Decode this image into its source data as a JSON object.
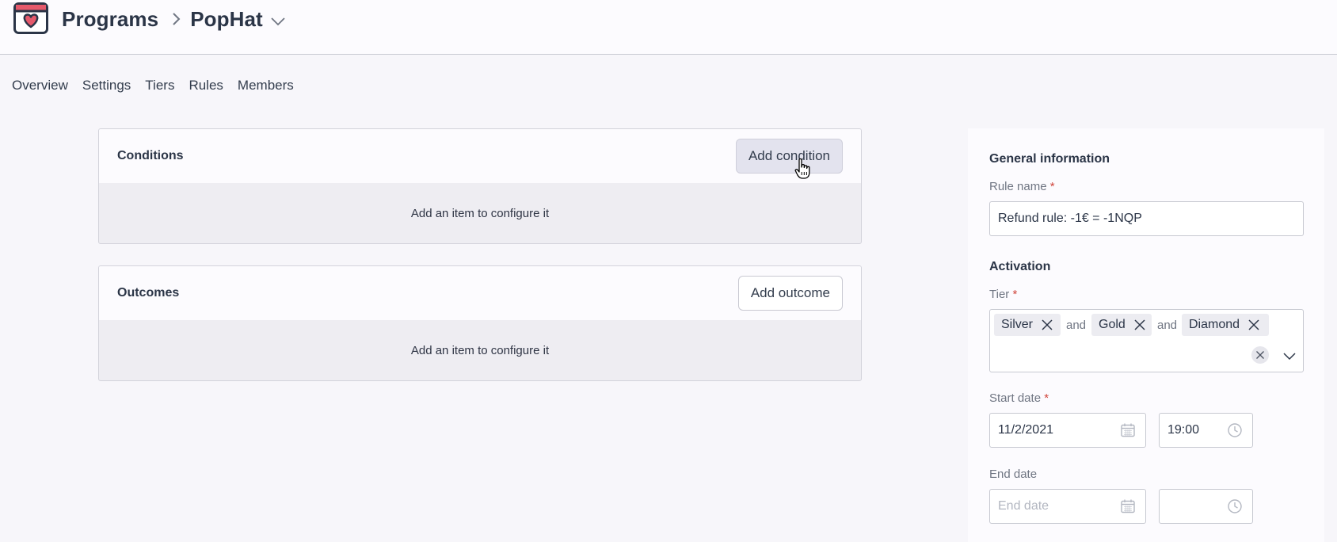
{
  "header": {
    "breadcrumb": [
      "Programs",
      "PopHat"
    ]
  },
  "tabs": [
    "Overview",
    "Settings",
    "Tiers",
    "Rules",
    "Members"
  ],
  "conditions": {
    "title": "Conditions",
    "button": "Add condition",
    "empty": "Add an item to configure it"
  },
  "outcomes": {
    "title": "Outcomes",
    "button": "Add outcome",
    "empty": "Add an item to configure it"
  },
  "panel": {
    "general_title": "General information",
    "rule_name_label": "Rule name",
    "rule_name_value": "Refund rule: -1€ = -1NQP",
    "activation_title": "Activation",
    "tier_label": "Tier",
    "tiers": [
      "Silver",
      "Gold",
      "Diamond"
    ],
    "tier_joiner": "and",
    "start_date_label": "Start date",
    "start_date_value": "11/2/2021",
    "start_time_value": "19:00",
    "end_date_label": "End date",
    "end_date_placeholder": "End date",
    "required_mark": "*"
  },
  "icons": {
    "logo": "heart-calendar-icon",
    "calendar": "calendar-icon",
    "clock": "clock-icon",
    "remove": "close-icon",
    "dropdown": "chevron-down-icon",
    "cursor": "hand-pointer-icon"
  },
  "colors": {
    "accent": "#e5596b",
    "text": "#2b3547",
    "required": "#d0453b"
  }
}
